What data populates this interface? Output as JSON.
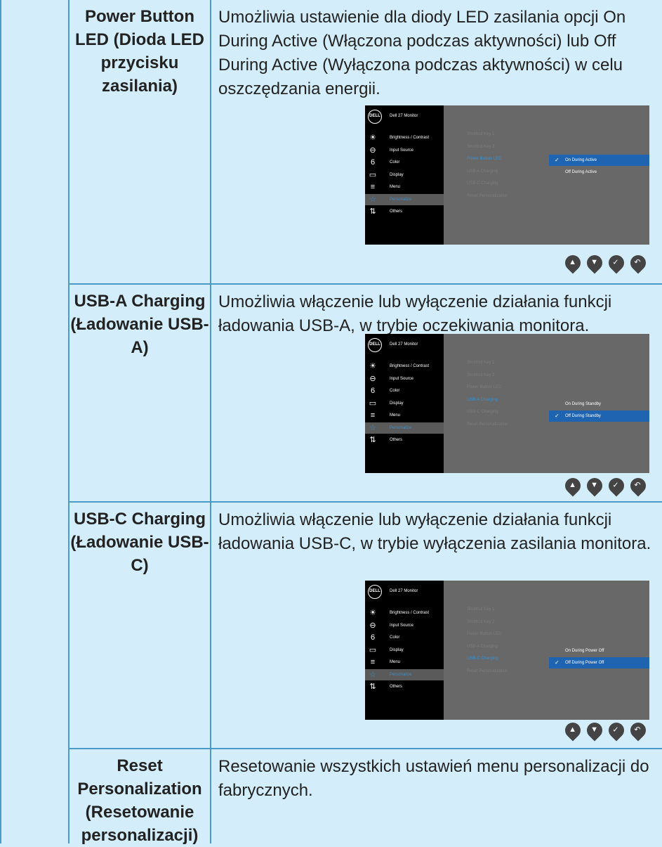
{
  "rows": [
    {
      "label": "Power Button LED (Dioda LED przycisku zasilania)",
      "description": "Umożliwia ustawienie dla diody LED zasilania opcji On During Active (Włączona podczas aktywności) lub Off During Active (Wyłączona podczas aktywności) w celu oszczędzania energii.",
      "osd": {
        "title": "Dell 27 Monitor",
        "logo": "DELL",
        "menu": [
          {
            "label": "Brightness / Contrast",
            "icon": "brightness-icon"
          },
          {
            "label": "Input Source",
            "icon": "input-source-icon"
          },
          {
            "label": "Color",
            "icon": "color-icon"
          },
          {
            "label": "Display",
            "icon": "display-icon"
          },
          {
            "label": "Menu",
            "icon": "menu-icon"
          },
          {
            "label": "Personalize",
            "icon": "star-icon"
          },
          {
            "label": "Others",
            "icon": "others-icon"
          }
        ],
        "submenu": [
          "Shortcut Key 1",
          "Shortcut Key 2",
          "Power Button LED",
          "USB-A Charging",
          "USB-C Charging",
          "Reset Personalization"
        ],
        "options": [
          "On During Active",
          "Off During Active"
        ],
        "selected_option": 0
      }
    },
    {
      "label": "USB-A Charging (Ładowanie USB-A)",
      "description": "Umożliwia włączenie lub wyłączenie działania funkcji ładowania USB-A, w trybie oczekiwania monitora.",
      "osd": {
        "title": "Dell 27 Monitor",
        "logo": "DELL",
        "menu": [
          {
            "label": "Brightness / Contrast",
            "icon": "brightness-icon"
          },
          {
            "label": "Input Source",
            "icon": "input-source-icon"
          },
          {
            "label": "Color",
            "icon": "color-icon"
          },
          {
            "label": "Display",
            "icon": "display-icon"
          },
          {
            "label": "Menu",
            "icon": "menu-icon"
          },
          {
            "label": "Personalize",
            "icon": "star-icon"
          },
          {
            "label": "Others",
            "icon": "others-icon"
          }
        ],
        "submenu": [
          "Shortcut Key 1",
          "Shortcut Key 2",
          "Power Button LED",
          "USB-A Charging",
          "USB-C Charging",
          "Reset Personalization"
        ],
        "options": [
          "On During Standby",
          "Off During Standby"
        ],
        "selected_option": 1
      }
    },
    {
      "label": "USB-C Charging (Ładowanie USB-C)",
      "description": "Umożliwia włączenie lub wyłączenie działania funkcji ładowania USB-C, w trybie wyłączenia zasilania monitora.",
      "osd": {
        "title": "Dell 27 Monitor",
        "logo": "DELL",
        "menu": [
          {
            "label": "Brightness / Contrast",
            "icon": "brightness-icon"
          },
          {
            "label": "Input Source",
            "icon": "input-source-icon"
          },
          {
            "label": "Color",
            "icon": "color-icon"
          },
          {
            "label": "Display",
            "icon": "display-icon"
          },
          {
            "label": "Menu",
            "icon": "menu-icon"
          },
          {
            "label": "Personalize",
            "icon": "star-icon"
          },
          {
            "label": "Others",
            "icon": "others-icon"
          }
        ],
        "submenu": [
          "Shortcut Key 1",
          "Shortcut Key 2",
          "Power Button LED",
          "USB-A Charging",
          "USB-C Charging",
          "Reset Personalization"
        ],
        "options": [
          "On During Power Off",
          "Off During Power Off"
        ],
        "selected_option": 1
      }
    },
    {
      "label": "Reset Personalization (Resetowanie personalizacji)",
      "description": "Resetowanie wszystkich ustawień menu personalizacji do fabrycznych."
    }
  ],
  "icons": {
    "nav": [
      "up-arrow-icon",
      "down-arrow-icon",
      "check-icon",
      "back-icon"
    ]
  },
  "colors": {
    "background": "#d3eefa",
    "border": "#4b9bc9",
    "osd_select": "#1f64b1",
    "osd_accent": "#3a8fcf"
  }
}
